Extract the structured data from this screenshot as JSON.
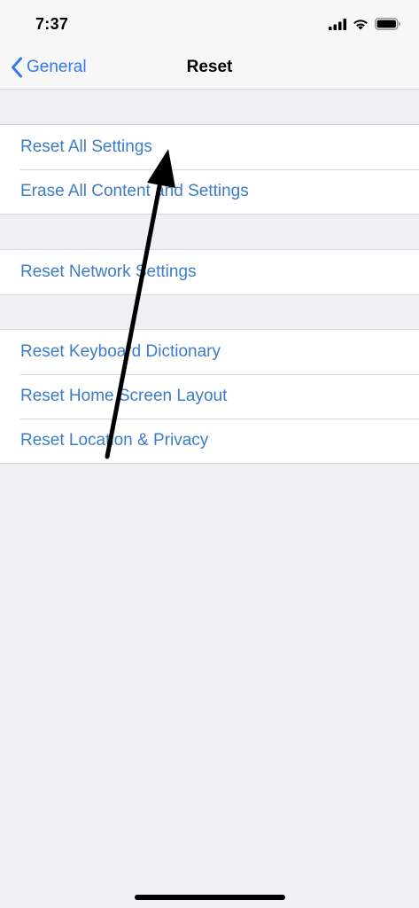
{
  "status_bar": {
    "time": "7:37",
    "icons": [
      "cellular-signal-icon",
      "wifi-icon",
      "battery-icon"
    ]
  },
  "nav": {
    "back_label": "General",
    "title": "Reset"
  },
  "groups": [
    {
      "items": [
        {
          "label": "Reset All Settings"
        },
        {
          "label": "Erase All Content and Settings"
        }
      ]
    },
    {
      "items": [
        {
          "label": "Reset Network Settings"
        }
      ]
    },
    {
      "items": [
        {
          "label": "Reset Keyboard Dictionary"
        },
        {
          "label": "Reset Home Screen Layout"
        },
        {
          "label": "Reset Location & Privacy"
        }
      ]
    }
  ],
  "colors": {
    "link_blue": "#3c7cc9",
    "nav_blue": "#3478f6",
    "background": "#efeff4",
    "bar_background": "#f7f7f7",
    "separator": "#d8d8dc",
    "annotation_arrow": "#000000"
  }
}
